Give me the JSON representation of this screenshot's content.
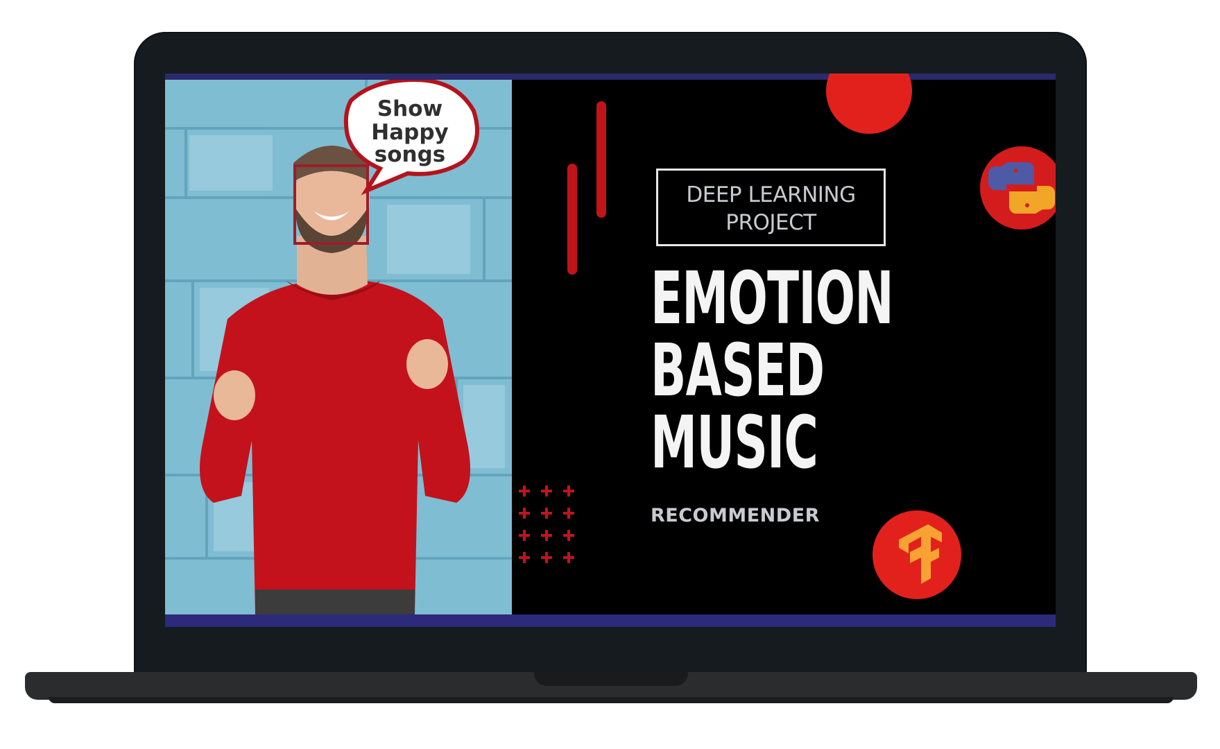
{
  "speech_bubble": {
    "lines": [
      "Show",
      "Happy",
      "songs"
    ]
  },
  "project_tag": {
    "line1": "DEEP LEARNING",
    "line2": "PROJECT"
  },
  "title": {
    "line1": "EMOTION",
    "line2": "BASED",
    "line3": "MUSIC"
  },
  "subtitle": "RECOMMENDER",
  "icons": {
    "top_right": "python-logo-icon",
    "bottom_right": "tensorflow-logo-icon"
  },
  "colors": {
    "accent_red": "#e3211c",
    "background": "#000000",
    "wall_blue": "#79b9cf",
    "sweater_red": "#c3121c",
    "bezel": "#161b20",
    "screen_bar": "#2d2a7c"
  }
}
